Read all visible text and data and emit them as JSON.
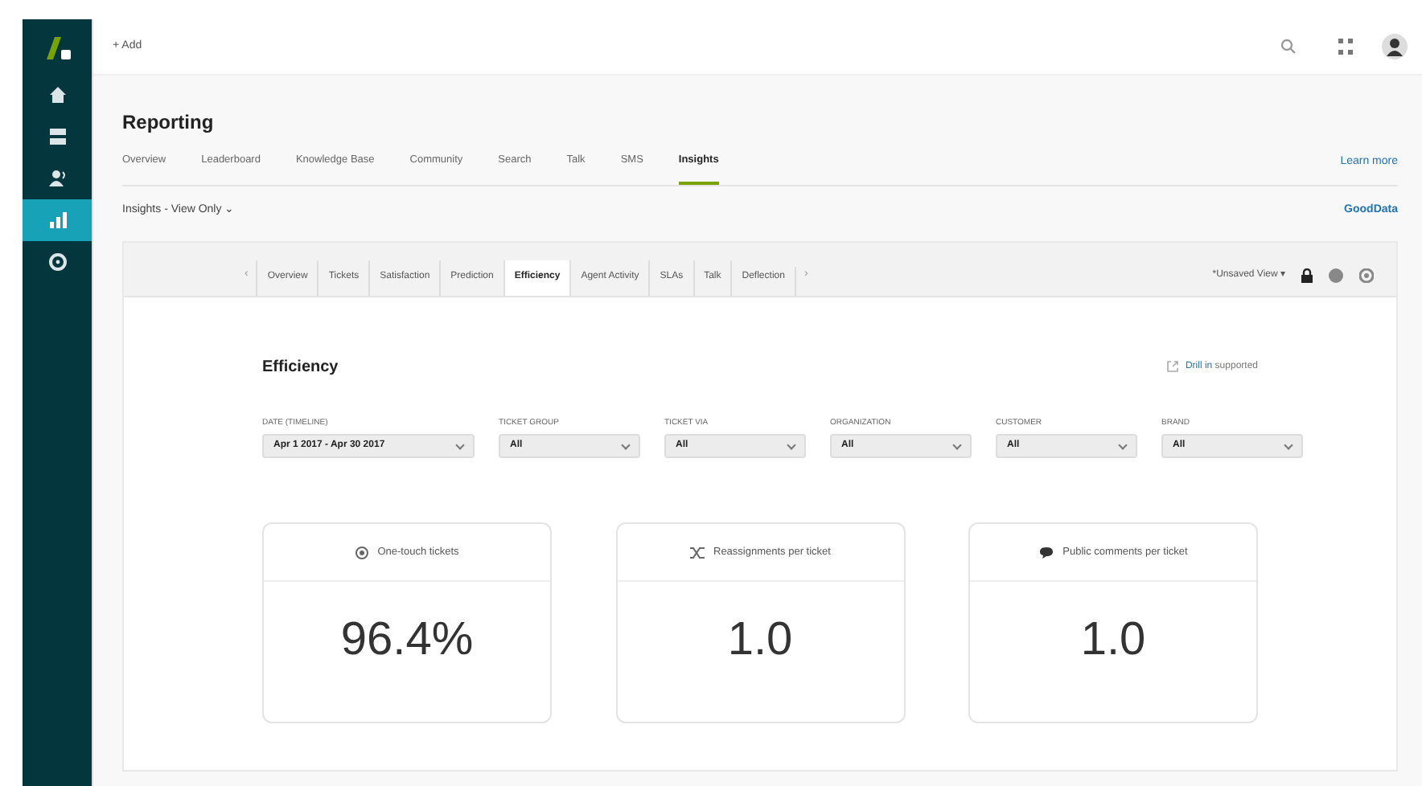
{
  "sidebar": {
    "items": [
      {
        "selected": false
      },
      {
        "selected": false
      },
      {
        "selected": false
      },
      {
        "selected": true
      },
      {
        "selected": false
      }
    ]
  },
  "header": {
    "add_label": "+ Add"
  },
  "page": {
    "title": "Reporting",
    "tabs": [
      {
        "label": "Overview",
        "selected": false
      },
      {
        "label": "Leaderboard",
        "selected": false
      },
      {
        "label": "Knowledge Base",
        "selected": false
      },
      {
        "label": "Community",
        "selected": false
      },
      {
        "label": "Search",
        "selected": false
      },
      {
        "label": "Talk",
        "selected": false
      },
      {
        "label": "SMS",
        "selected": false
      },
      {
        "label": "Insights",
        "selected": true
      }
    ],
    "learn_more": "Learn more",
    "view_selector": "Insights - View Only ⌄",
    "goodData": "GoodData"
  },
  "dashboard": {
    "prev": "‹",
    "next": "›",
    "tabs": [
      {
        "label": "Overview",
        "selected": false
      },
      {
        "label": "Tickets",
        "selected": false
      },
      {
        "label": "Satisfaction",
        "selected": false
      },
      {
        "label": "Prediction",
        "selected": false
      },
      {
        "label": "Efficiency",
        "selected": true
      },
      {
        "label": "Agent Activity",
        "selected": false
      },
      {
        "label": "SLAs",
        "selected": false
      },
      {
        "label": "Talk",
        "selected": false
      },
      {
        "label": "Deflection",
        "selected": false
      }
    ],
    "view": "*Unsaved View ▾",
    "title": "Efficiency",
    "drill_link": "Drill in",
    "drill_text": "supported",
    "filters": [
      {
        "label": "DATE (TIMELINE)",
        "value": "Apr 1 2017 - Apr 30 2017"
      },
      {
        "label": "TICKET GROUP",
        "value": "All"
      },
      {
        "label": "TICKET VIA",
        "value": "All"
      },
      {
        "label": "ORGANIZATION",
        "value": "All"
      },
      {
        "label": "CUSTOMER",
        "value": "All"
      },
      {
        "label": "BRAND",
        "value": "All"
      }
    ],
    "metrics": [
      {
        "label": "One-touch tickets",
        "value": "96.4%"
      },
      {
        "label": "Reassignments per ticket",
        "value": "1.0"
      },
      {
        "label": "Public comments per ticket",
        "value": "1.0"
      }
    ]
  }
}
